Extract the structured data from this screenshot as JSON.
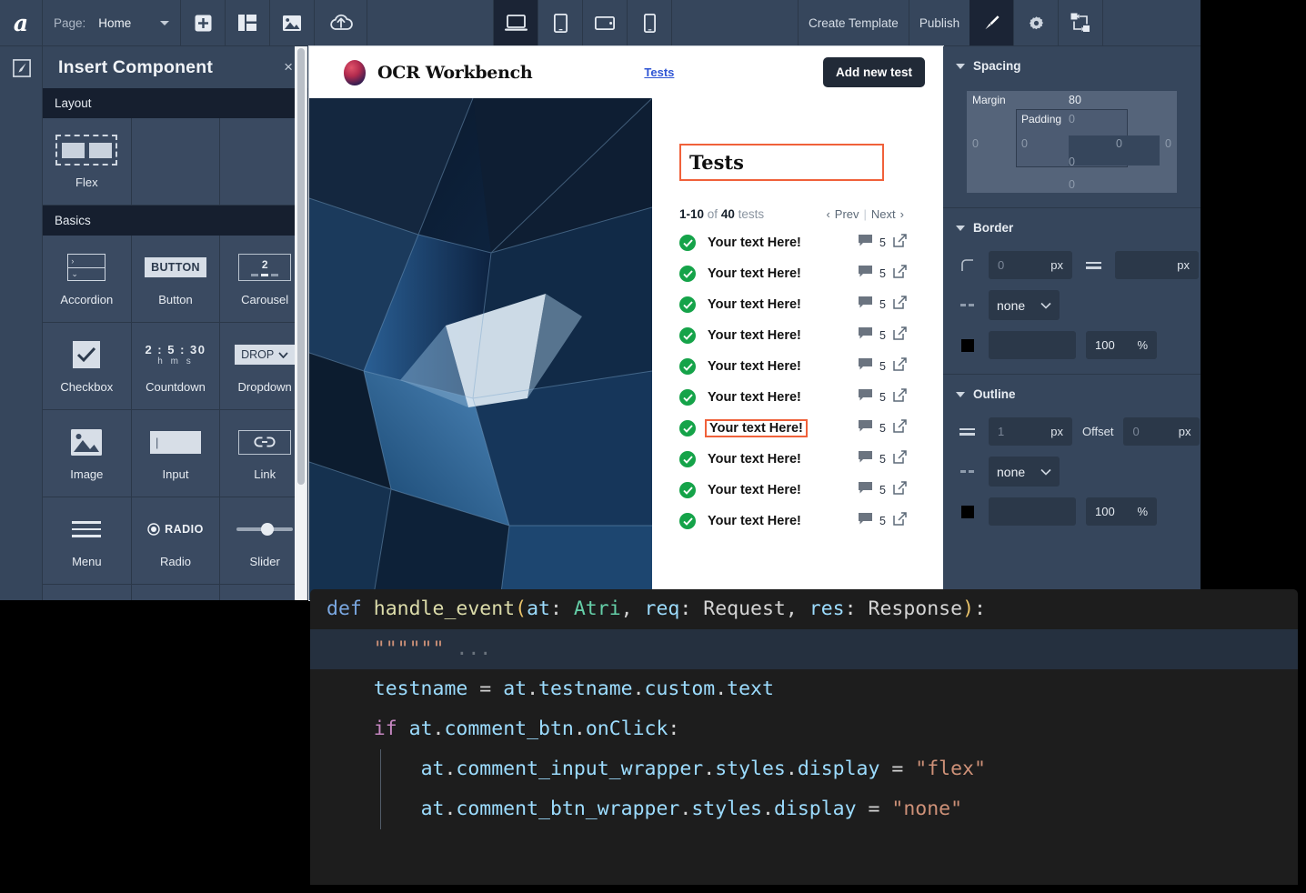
{
  "toolbar": {
    "logo": "a",
    "page_label": "Page:",
    "page_value": "Home",
    "icons": [
      {
        "name": "add-icon"
      },
      {
        "name": "layout-panel-icon"
      },
      {
        "name": "image-icon"
      },
      {
        "name": "publish-cloud-icon"
      }
    ],
    "devices": [
      {
        "name": "desktop-icon",
        "active": true
      },
      {
        "name": "tablet-icon",
        "active": false
      },
      {
        "name": "tablet-landscape-icon",
        "active": false
      },
      {
        "name": "mobile-icon",
        "active": false
      }
    ],
    "create_template": "Create Template",
    "publish": "Publish",
    "brush_icon": "brush-icon",
    "settings_icon": "gear-icon",
    "flow_icon": "node-flow-icon"
  },
  "left_rail": {
    "icon": "edit-canvas-icon"
  },
  "insert_panel": {
    "title": "Insert Component",
    "close": "×",
    "groups": [
      {
        "name": "Layout",
        "items": [
          {
            "label": "Flex",
            "icon": "flex-glyph"
          },
          {
            "label": "",
            "icon": "empty"
          },
          {
            "label": "",
            "icon": "empty"
          }
        ]
      },
      {
        "name": "Basics",
        "items": [
          {
            "label": "Accordion",
            "icon": "accordion-glyph"
          },
          {
            "label": "Button",
            "icon": "button-glyph",
            "text": "BUTTON"
          },
          {
            "label": "Carousel",
            "icon": "carousel-glyph",
            "text": "2"
          },
          {
            "label": "Checkbox",
            "icon": "checkbox-glyph"
          },
          {
            "label": "Countdown",
            "icon": "countdown-glyph",
            "text": "2 : 5 : 30",
            "units": "h   m    s"
          },
          {
            "label": "Dropdown",
            "icon": "dropdown-glyph",
            "text": "DROP"
          },
          {
            "label": "Image",
            "icon": "image-glyph"
          },
          {
            "label": "Input",
            "icon": "input-glyph"
          },
          {
            "label": "Link",
            "icon": "link-glyph"
          },
          {
            "label": "Menu",
            "icon": "menu-glyph"
          },
          {
            "label": "Radio",
            "icon": "radio-glyph",
            "text": "RADIO"
          },
          {
            "label": "Slider",
            "icon": "slider-glyph"
          },
          {
            "label": "",
            "icon": "stepper-glyph"
          },
          {
            "label": "",
            "icon": "bar-glyph"
          },
          {
            "label": "",
            "icon": "switch-glyph"
          }
        ]
      }
    ]
  },
  "preview": {
    "brand_name": "OCR Workbench",
    "nav_link": "Tests",
    "add_button": "Add new test",
    "heading": "Tests",
    "pager": {
      "range": "1-10",
      "of": "of",
      "total": "40",
      "unit": "tests",
      "prev": "Prev",
      "next": "Next"
    },
    "tests": [
      {
        "name": "Your text Here!",
        "comments": "5",
        "selected": false
      },
      {
        "name": "Your text Here!",
        "comments": "5",
        "selected": false
      },
      {
        "name": "Your text Here!",
        "comments": "5",
        "selected": false
      },
      {
        "name": "Your text Here!",
        "comments": "5",
        "selected": false
      },
      {
        "name": "Your text Here!",
        "comments": "5",
        "selected": false
      },
      {
        "name": "Your text Here!",
        "comments": "5",
        "selected": false
      },
      {
        "name": "Your text Here!",
        "comments": "5",
        "selected": true
      },
      {
        "name": "Your text Here!",
        "comments": "5",
        "selected": false
      },
      {
        "name": "Your text Here!",
        "comments": "5",
        "selected": false
      },
      {
        "name": "Your text Here!",
        "comments": "5",
        "selected": false
      }
    ]
  },
  "properties": {
    "spacing": {
      "title": "Spacing",
      "margin_label": "Margin",
      "padding_label": "Padding",
      "margin_top": "80",
      "margin_left": "0",
      "margin_right": "0",
      "margin_bottom": "0",
      "padding_top": "0",
      "padding_left": "0",
      "padding_right": "0",
      "padding_bottom": "0"
    },
    "border": {
      "title": "Border",
      "radius_value": "0",
      "radius_unit": "px",
      "width_value": "",
      "width_unit": "px",
      "style_value": "none",
      "color_value": "",
      "opacity_value": "100",
      "opacity_unit": "%"
    },
    "outline": {
      "title": "Outline",
      "width_value": "1",
      "width_unit": "px",
      "offset_label": "Offset",
      "offset_value": "0",
      "offset_unit": "px",
      "style_value": "none",
      "color_value": "",
      "opacity_value": "100",
      "opacity_unit": "%"
    }
  },
  "code": {
    "lines": [
      {
        "indent": false,
        "highlight": false,
        "tokens": [
          {
            "t": "def ",
            "c": "k-def"
          },
          {
            "t": "handle_event",
            "c": "k-fn"
          },
          {
            "t": "(",
            "c": "k-par"
          },
          {
            "t": "at",
            "c": "k-arg"
          },
          {
            "t": ": ",
            "c": "k-plain"
          },
          {
            "t": "Atri",
            "c": "k-type"
          },
          {
            "t": ", ",
            "c": "k-plain"
          },
          {
            "t": "req",
            "c": "k-arg"
          },
          {
            "t": ": ",
            "c": "k-plain"
          },
          {
            "t": "Request",
            "c": "k-plain"
          },
          {
            "t": ", ",
            "c": "k-plain"
          },
          {
            "t": "res",
            "c": "k-arg"
          },
          {
            "t": ": ",
            "c": "k-plain"
          },
          {
            "t": "Response",
            "c": "k-plain"
          },
          {
            "t": ")",
            "c": "k-par"
          },
          {
            "t": ":",
            "c": "k-plain"
          }
        ]
      },
      {
        "indent": false,
        "highlight": true,
        "tokens": [
          {
            "t": "    \"\"\"\"\"\"",
            "c": "k-str"
          },
          {
            "t": " ...",
            "c": "k-com"
          }
        ]
      },
      {
        "indent": false,
        "highlight": false,
        "tokens": [
          {
            "t": "    ",
            "c": "k-plain"
          },
          {
            "t": "testname",
            "c": "k-attr"
          },
          {
            "t": " = ",
            "c": "k-op"
          },
          {
            "t": "at",
            "c": "k-attr"
          },
          {
            "t": ".",
            "c": "k-dot"
          },
          {
            "t": "testname",
            "c": "k-attr"
          },
          {
            "t": ".",
            "c": "k-dot"
          },
          {
            "t": "custom",
            "c": "k-attr"
          },
          {
            "t": ".",
            "c": "k-dot"
          },
          {
            "t": "text",
            "c": "k-attr"
          }
        ]
      },
      {
        "indent": false,
        "highlight": false,
        "tokens": [
          {
            "t": "",
            "c": "k-plain"
          }
        ]
      },
      {
        "indent": false,
        "highlight": false,
        "tokens": [
          {
            "t": "    ",
            "c": "k-plain"
          },
          {
            "t": "if",
            "c": "k-if"
          },
          {
            "t": " ",
            "c": "k-plain"
          },
          {
            "t": "at",
            "c": "k-attr"
          },
          {
            "t": ".",
            "c": "k-dot"
          },
          {
            "t": "comment_btn",
            "c": "k-attr"
          },
          {
            "t": ".",
            "c": "k-dot"
          },
          {
            "t": "onClick",
            "c": "k-attr"
          },
          {
            "t": ":",
            "c": "k-plain"
          }
        ]
      },
      {
        "indent": true,
        "highlight": false,
        "tokens": [
          {
            "t": "        ",
            "c": "k-plain"
          },
          {
            "t": "at",
            "c": "k-attr"
          },
          {
            "t": ".",
            "c": "k-dot"
          },
          {
            "t": "comment_input_wrapper",
            "c": "k-attr"
          },
          {
            "t": ".",
            "c": "k-dot"
          },
          {
            "t": "styles",
            "c": "k-attr"
          },
          {
            "t": ".",
            "c": "k-dot"
          },
          {
            "t": "display",
            "c": "k-attr"
          },
          {
            "t": " = ",
            "c": "k-op"
          },
          {
            "t": "\"flex\"",
            "c": "k-str"
          }
        ]
      },
      {
        "indent": true,
        "highlight": false,
        "tokens": [
          {
            "t": "        ",
            "c": "k-plain"
          },
          {
            "t": "at",
            "c": "k-attr"
          },
          {
            "t": ".",
            "c": "k-dot"
          },
          {
            "t": "comment_btn_wrapper",
            "c": "k-attr"
          },
          {
            "t": ".",
            "c": "k-dot"
          },
          {
            "t": "styles",
            "c": "k-attr"
          },
          {
            "t": ".",
            "c": "k-dot"
          },
          {
            "t": "display",
            "c": "k-attr"
          },
          {
            "t": " = ",
            "c": "k-op"
          },
          {
            "t": "\"none\"",
            "c": "k-str"
          }
        ]
      }
    ]
  },
  "colors": {
    "panel_bg": "#36465c",
    "panel_dark": "#161f2f",
    "accent_orange": "#f0613a",
    "success_green": "#15a349",
    "link_blue": "#2f55d4",
    "dark_button": "#212a37",
    "code_bg": "#1d1d1d"
  }
}
